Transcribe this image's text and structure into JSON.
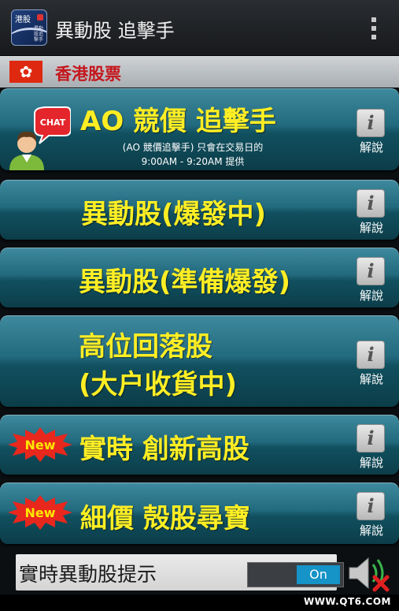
{
  "action_bar": {
    "title": "異動股 追擊手",
    "icon_lettering": {
      "top": "港股",
      "bottom": "異動股追擊手"
    }
  },
  "section": {
    "title": "香港股票",
    "flag_icon": "hong-kong-flag"
  },
  "menu": {
    "items": [
      {
        "id": "ao-auction",
        "title": "AO 競價 追擊手",
        "subtitle_line1": "(AO 競價追擊手) 只會在交易日的",
        "subtitle_line2": "9:00AM - 9:20AM 提供",
        "info_label": "解說",
        "badge": "chat"
      },
      {
        "id": "active-exploding",
        "title": "異動股(爆發中)",
        "info_label": "解說"
      },
      {
        "id": "active-ready",
        "title": "異動股(準備爆發)",
        "info_label": "解說"
      },
      {
        "id": "high-pullback",
        "title_line1": "高位回落股",
        "title_line2": "(大户收貨中)",
        "info_label": "解說"
      },
      {
        "id": "realtime-new-high",
        "title": "實時 創新高股",
        "info_label": "解說",
        "badge": "new"
      },
      {
        "id": "penny-shell",
        "title": "細價 殻股尋寶",
        "info_label": "解說",
        "badge": "new"
      }
    ],
    "chat_badge_text": "CHAT",
    "new_badge_text": "New",
    "info_glyph": "i"
  },
  "bottom": {
    "alert_label": "實時異動股提示",
    "toggle_state": "On",
    "sound_icon": "speaker-muted-icon"
  },
  "watermark": "WWW.QT6.COM",
  "colors": {
    "title_yellow": "#ffee24",
    "section_red": "#c4171d",
    "toggle_blue": "#1693c7",
    "item_teal": "#226a7e"
  }
}
